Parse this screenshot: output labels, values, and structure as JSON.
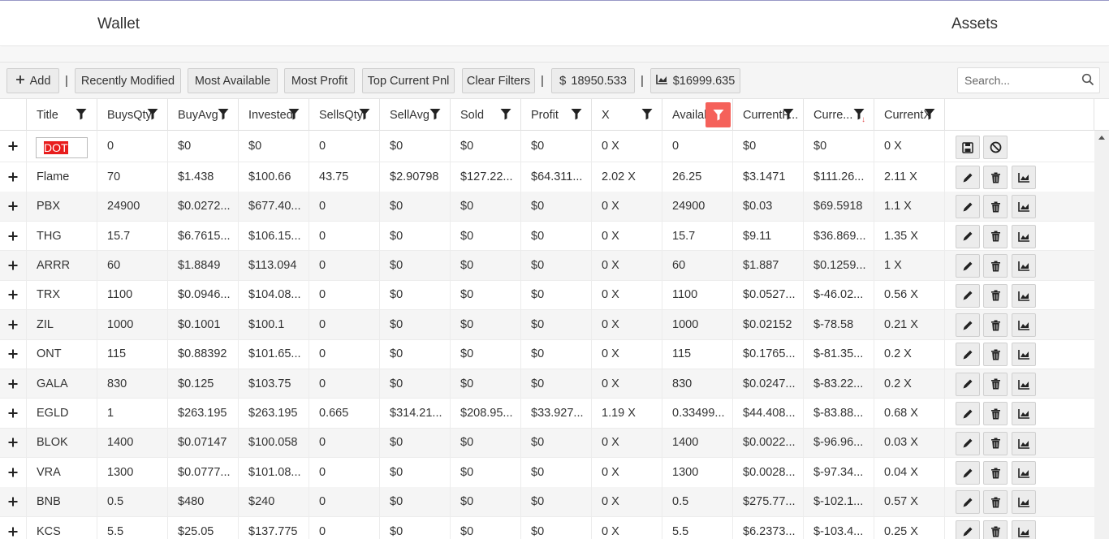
{
  "nav": {
    "wallet": "Wallet",
    "assets": "Assets"
  },
  "toolbar": {
    "add": "Add",
    "separator": "|",
    "recently_modified": "Recently Modified",
    "most_available": "Most Available",
    "most_profit": "Most Profit",
    "top_current_pnl": "Top Current Pnl",
    "clear_filters": "Clear Filters",
    "invested_total": "18950.533",
    "current_total": "$16999.635",
    "dollar_symbol": "$",
    "search_placeholder": "Search..."
  },
  "columns": [
    "Title",
    "BuysQty",
    "BuyAvg",
    "Invested",
    "SellsQty",
    "SellAvg",
    "Sold",
    "Profit",
    "X",
    "Availal",
    "CurrentP...",
    "Curre...",
    "CurrentX"
  ],
  "new_row": {
    "title_value": "DOT",
    "values": [
      "0",
      "$0",
      "$0",
      "0",
      "$0",
      "$0",
      "$0",
      "0 X",
      "0",
      "$0",
      "$0",
      "0 X"
    ]
  },
  "rows": [
    [
      "Flame",
      "70",
      "$1.438",
      "$100.66",
      "43.75",
      "$2.90798",
      "$127.22...",
      "$64.311...",
      "2.02 X",
      "26.25",
      "$3.1471",
      "$111.26...",
      "2.11 X"
    ],
    [
      "PBX",
      "24900",
      "$0.0272...",
      "$677.40...",
      "0",
      "$0",
      "$0",
      "$0",
      "0 X",
      "24900",
      "$0.03",
      "$69.5918",
      "1.1 X"
    ],
    [
      "THG",
      "15.7",
      "$6.7615...",
      "$106.15...",
      "0",
      "$0",
      "$0",
      "$0",
      "0 X",
      "15.7",
      "$9.11",
      "$36.869...",
      "1.35 X"
    ],
    [
      "ARRR",
      "60",
      "$1.8849",
      "$113.094",
      "0",
      "$0",
      "$0",
      "$0",
      "0 X",
      "60",
      "$1.887",
      "$0.1259...",
      "1 X"
    ],
    [
      "TRX",
      "1100",
      "$0.0946...",
      "$104.08...",
      "0",
      "$0",
      "$0",
      "$0",
      "0 X",
      "1100",
      "$0.0527...",
      "$-46.02...",
      "0.56 X"
    ],
    [
      "ZIL",
      "1000",
      "$0.1001",
      "$100.1",
      "0",
      "$0",
      "$0",
      "$0",
      "0 X",
      "1000",
      "$0.02152",
      "$-78.58",
      "0.21 X"
    ],
    [
      "ONT",
      "115",
      "$0.88392",
      "$101.65...",
      "0",
      "$0",
      "$0",
      "$0",
      "0 X",
      "115",
      "$0.1765...",
      "$-81.35...",
      "0.2 X"
    ],
    [
      "GALA",
      "830",
      "$0.125",
      "$103.75",
      "0",
      "$0",
      "$0",
      "$0",
      "0 X",
      "830",
      "$0.0247...",
      "$-83.22...",
      "0.2 X"
    ],
    [
      "EGLD",
      "1",
      "$263.195",
      "$263.195",
      "0.665",
      "$314.21...",
      "$208.95...",
      "$33.927...",
      "1.19 X",
      "0.33499...",
      "$44.408...",
      "$-83.88...",
      "0.68 X"
    ],
    [
      "BLOK",
      "1400",
      "$0.07147",
      "$100.058",
      "0",
      "$0",
      "$0",
      "$0",
      "0 X",
      "1400",
      "$0.0022...",
      "$-96.96...",
      "0.03 X"
    ],
    [
      "VRA",
      "1300",
      "$0.0777...",
      "$101.08...",
      "0",
      "$0",
      "$0",
      "$0",
      "0 X",
      "1300",
      "$0.0028...",
      "$-97.34...",
      "0.04 X"
    ],
    [
      "BNB",
      "0.5",
      "$480",
      "$240",
      "0",
      "$0",
      "$0",
      "$0",
      "0 X",
      "0.5",
      "$275.77...",
      "$-102.1...",
      "0.57 X"
    ],
    [
      "KCS",
      "5.5",
      "$25.05",
      "$137.775",
      "0",
      "$0",
      "$0",
      "$0",
      "0 X",
      "5.5",
      "$6.2373...",
      "$-103.4...",
      "0.25 X"
    ]
  ],
  "icons": {
    "add": "plus-icon",
    "chart": "area-chart-icon",
    "filter": "funnel-icon",
    "search": "search-icon",
    "save": "floppy-icon",
    "cancel": "ban-icon",
    "edit": "pencil-icon",
    "delete": "trash-icon",
    "expand": "plus-icon"
  },
  "colors": {
    "active_filter": "#f5615a",
    "highlight": "#e81d1d"
  }
}
